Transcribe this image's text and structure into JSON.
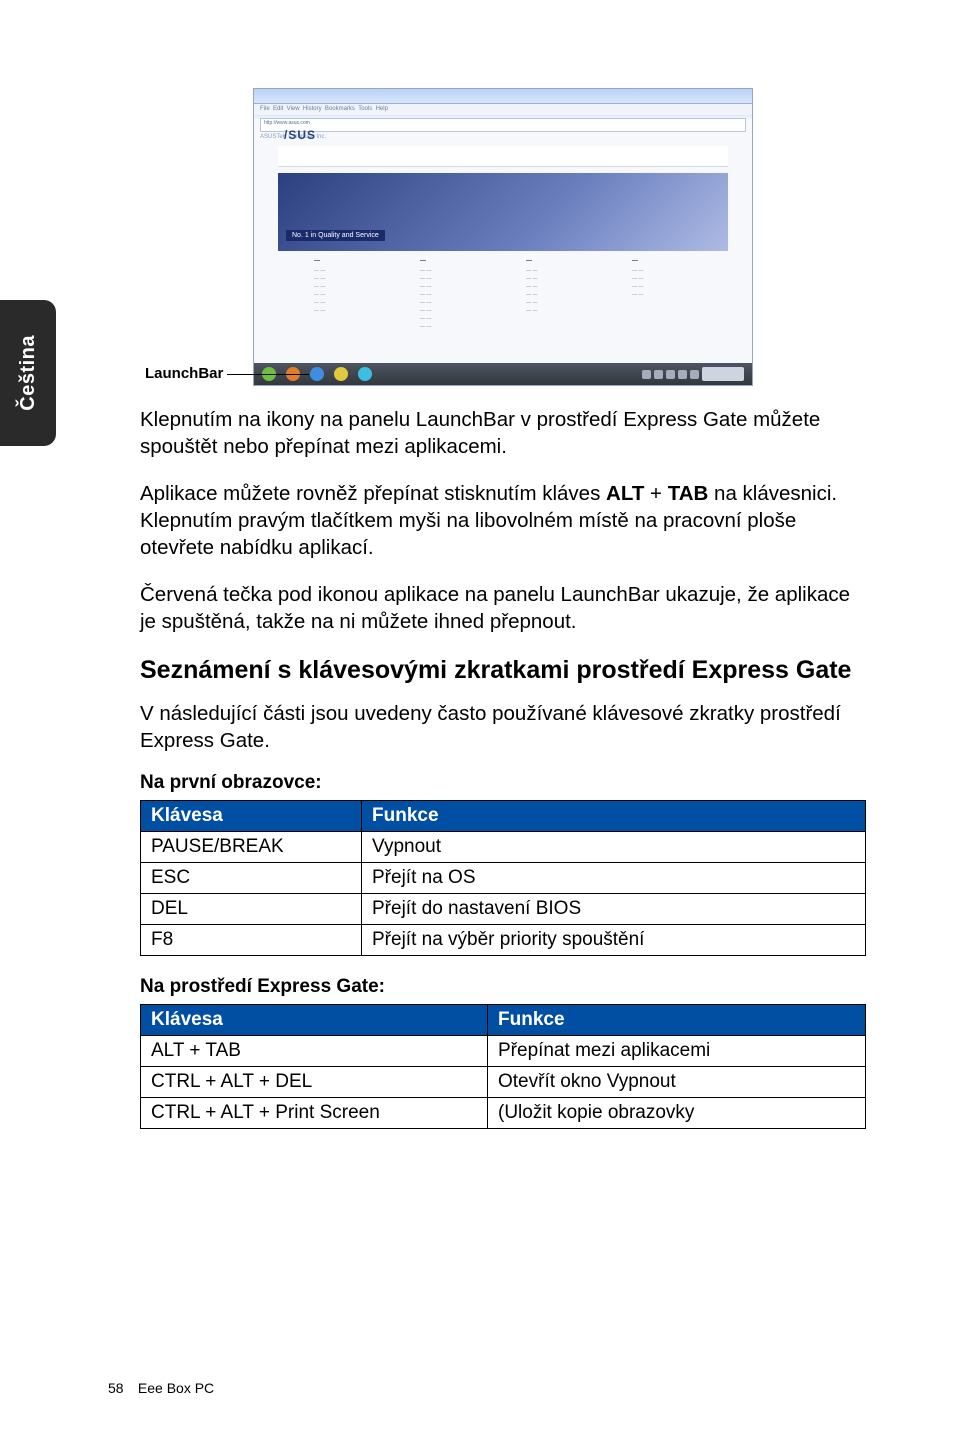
{
  "sideTab": "Čeština",
  "screenshot": {
    "logo": "/SUS",
    "heroBand": "No. 1 in Quality and Service",
    "launchbarLabel": "LaunchBar"
  },
  "paragraphs": {
    "p1": "Klepnutím na ikony na panelu LaunchBar v prostředí Express Gate můžete spouštět nebo přepínat mezi aplikacemi.",
    "p2_a": "Aplikace můžete rovněž přepínat stisknutím kláves ",
    "p2_alt": "ALT",
    "p2_plus": " + ",
    "p2_tab": "TAB",
    "p2_b": " na klávesnici. Klepnutím pravým tlačítkem myši na libovolném místě na pracovní ploše otevřete nabídku aplikací.",
    "p3": "Červená tečka pod ikonou aplikace na panelu LaunchBar ukazuje, že aplikace je spuštěná, takže na ni můžete ihned přepnout."
  },
  "sectionTitle": "Seznámení s klávesovými zkratkami prostředí Express Gate",
  "lead": "V následující části jsou uvedeny často používané klávesové zkratky prostředí Express Gate.",
  "table1": {
    "caption": "Na první obrazovce:",
    "head": {
      "k": "Klávesa",
      "f": "Funkce"
    },
    "rows": [
      {
        "k": "PAUSE/BREAK",
        "f": "Vypnout"
      },
      {
        "k": "ESC",
        "f": "Přejít na OS"
      },
      {
        "k": "DEL",
        "f": "Přejít do nastavení BIOS"
      },
      {
        "k": "F8",
        "f": "Přejít na výběr priority spouštění"
      }
    ]
  },
  "table2": {
    "caption": "Na prostředí Express Gate:",
    "head": {
      "k": "Klávesa",
      "f": "Funkce"
    },
    "rows": [
      {
        "k": "ALT + TAB",
        "f": "Přepínat mezi aplikacemi"
      },
      {
        "k": "CTRL + ALT + DEL",
        "f": "Otevřít okno Vypnout"
      },
      {
        "k": "CTRL + ALT + Print Screen",
        "f": "(Uložit kopie obrazovky"
      }
    ]
  },
  "footer": {
    "page": "58",
    "title": "Eee Box PC"
  }
}
